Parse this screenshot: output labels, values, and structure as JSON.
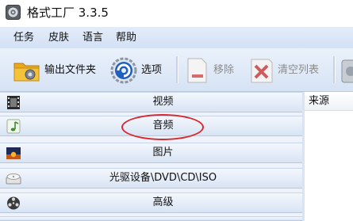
{
  "window": {
    "title": "格式工厂 3.3.5"
  },
  "menu": [
    {
      "label": "任务"
    },
    {
      "label": "皮肤"
    },
    {
      "label": "语言"
    },
    {
      "label": "帮助"
    }
  ],
  "toolbar": {
    "output_folder": {
      "label": "输出文件夹",
      "icon": "folder-icon",
      "enabled": true
    },
    "options": {
      "label": "选项",
      "icon": "gear-icon",
      "enabled": true
    },
    "remove": {
      "label": "移除",
      "icon": "remove-document-icon",
      "enabled": false
    },
    "clear_list": {
      "label": "清空列表",
      "icon": "clear-list-icon",
      "enabled": false
    }
  },
  "categories": [
    {
      "label": "视频",
      "icon": "film-icon"
    },
    {
      "label": "音频",
      "icon": "music-note-icon"
    },
    {
      "label": "图片",
      "icon": "picture-icon"
    },
    {
      "label": "光驱设备\\DVD\\CD\\ISO",
      "icon": "disc-drive-icon"
    },
    {
      "label": "高级",
      "icon": "film-reel-icon"
    }
  ],
  "task_list": {
    "columns": [
      {
        "label": "来源"
      }
    ]
  },
  "colors": {
    "highlight": "#d9282f",
    "accent": "#2d6fd0"
  }
}
